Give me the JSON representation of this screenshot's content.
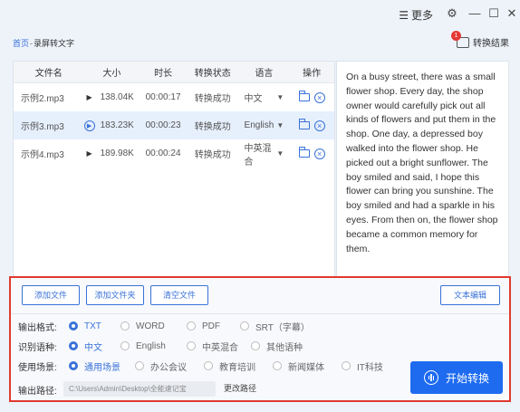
{
  "titlebar": {
    "more_label": "更多"
  },
  "breadcrumb": {
    "home": "首页",
    "separator": "-",
    "current": "录屏转文字"
  },
  "result": {
    "badge_count": "1",
    "label": "转换结果"
  },
  "table": {
    "headers": [
      "文件名",
      "大小",
      "时长",
      "转换状态",
      "语言",
      "操作"
    ],
    "rows": [
      {
        "name": "示例2.mp3",
        "size": "138.04K",
        "duration": "00:00:17",
        "status": "转换成功",
        "language": "中文",
        "selected": false
      },
      {
        "name": "示例3.mp3",
        "size": "183.23K",
        "duration": "00:00:23",
        "status": "转换成功",
        "language": "English",
        "selected": true
      },
      {
        "name": "示例4.mp3",
        "size": "189.98K",
        "duration": "00:00:24",
        "status": "转换成功",
        "language": "中英混合",
        "selected": false
      }
    ]
  },
  "transcript": "On a busy street, there was a small flower shop. Every day, the shop owner would carefully pick out all kinds of flowers and put them in the shop. One day, a depressed boy walked into the flower shop. He picked out a bright sunflower. The boy smiled and said, I hope this flower can bring you sunshine. The boy smiled and had a sparkle in his eyes. From then on, the flower shop became a common memory for them.",
  "buttons": {
    "add_file": "添加文件",
    "add_folder": "添加文件夹",
    "clear_files": "清空文件",
    "text_edit": "文本编辑",
    "start": "开始转换",
    "change_path": "更改路径"
  },
  "output_format": {
    "label": "输出格式:",
    "options": [
      "TXT",
      "WORD",
      "PDF",
      "SRT（字幕）"
    ],
    "selected": "TXT"
  },
  "language": {
    "label": "识别语种:",
    "options": [
      "中文",
      "English",
      "中英混合",
      "其他语种"
    ],
    "selected": "中文"
  },
  "scene": {
    "label": "使用场景:",
    "options": [
      "通用场景",
      "办公会议",
      "教育培训",
      "新闻媒体",
      "IT科技"
    ],
    "selected": "通用场景"
  },
  "output_path": {
    "label": "输出路径:",
    "value": "C:\\Users\\Admin\\Desktop\\全能速记宝"
  },
  "colors": {
    "accent": "#1e6bf0",
    "highlight_border": "#e03a2f",
    "selected_row": "#e6effc"
  }
}
